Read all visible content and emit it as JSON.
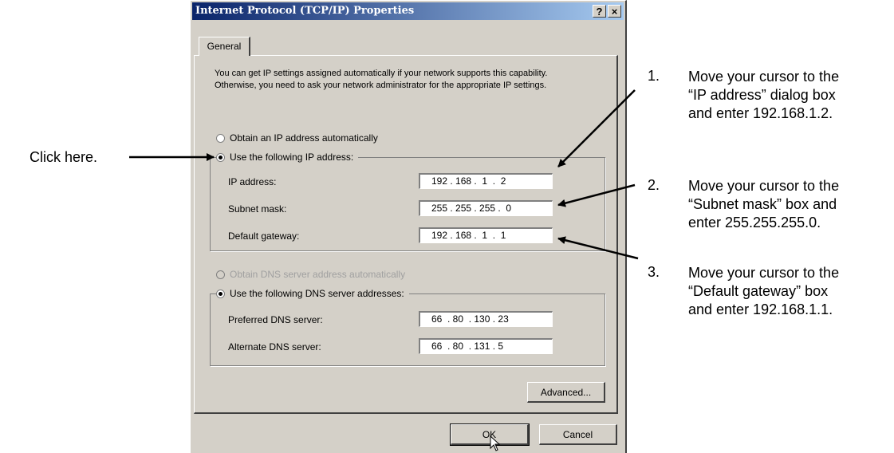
{
  "dialog": {
    "title": "Internet Protocol (TCP/IP) Properties",
    "help_button": "?",
    "close_button": "×",
    "tab_general": "General",
    "intro": "You can get IP settings assigned automatically if your network supports this capability. Otherwise, you need to ask your network administrator for the appropriate IP settings.",
    "radio_obtain_ip": "Obtain an IP address automatically",
    "radio_use_ip": "Use the following IP address:",
    "ip_label": "IP address:",
    "ip_value": "192 . 168 .  1  .  2",
    "subnet_label": "Subnet mask:",
    "subnet_value": "255 . 255 . 255 .  0",
    "gateway_label": "Default gateway:",
    "gateway_value": "192 . 168 .  1  .  1",
    "radio_obtain_dns": "Obtain DNS server address automatically",
    "radio_use_dns": "Use the following DNS server addresses:",
    "preferred_dns_label": "Preferred DNS server:",
    "preferred_dns_value": "66  . 80  . 130 . 23",
    "alternate_dns_label": "Alternate DNS server:",
    "alternate_dns_value": "66  . 80  . 131 . 5",
    "advanced_button": "Advanced...",
    "ok_button": "OK",
    "cancel_button": "Cancel"
  },
  "annotations": {
    "click_here": "Click here.",
    "step1_num": "1.",
    "step1_lines": [
      "Move your cursor to the",
      "“IP address” dialog box",
      "and enter 192.168.1.2."
    ],
    "step2_num": "2.",
    "step2_lines": [
      "Move your cursor to the",
      "“Subnet mask” box and",
      "enter 255.255.255.0."
    ],
    "step3_num": "3.",
    "step3_lines": [
      "Move your cursor to the",
      "“Default gateway” box",
      "and enter 192.168.1.1."
    ]
  },
  "colors": {
    "dialog_bg": "#d4d0c8",
    "titlebar_start": "#0a246a",
    "titlebar_end": "#a6caf0"
  }
}
